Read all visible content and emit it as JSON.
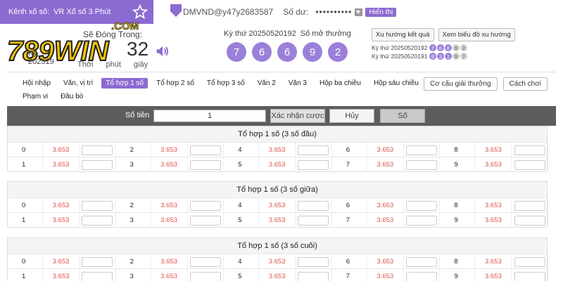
{
  "header": {
    "channel_label": "Kênh xổ số:",
    "channel_name": "VR Xổ số 3 Phút",
    "username": "DMVND@y47y2683587",
    "balance_label": "Số dư:",
    "balance_value": "••••••••••",
    "show_label": "Hiển thị",
    "logo_text": "789WIN",
    "logo_domain": ".COM",
    "close_label": "Sẽ Đóng Trong:",
    "period_prefix": "Kỳ",
    "period_fragment": "2025",
    "period_suffix": "19",
    "timer_value": "32",
    "unit_minute_prefix": "Thới",
    "unit_minute": "phút",
    "unit_second": "giây",
    "draw_label": "Kỳ thứ 20250520192",
    "draw_result_label": "Số mở thưởng",
    "balls": [
      "7",
      "6",
      "6",
      "9",
      "2"
    ],
    "trend_button": "Xu hướng kết quả",
    "chart_button": "Xem biểu đồ xu hướng",
    "history": [
      {
        "label": "Kỳ thứ 20250520192",
        "balls": [
          "7",
          "6",
          "6",
          "9",
          "2"
        ]
      },
      {
        "label": "Kỳ thứ 20250520191",
        "balls": [
          "9",
          "3",
          "1",
          "9",
          "7"
        ]
      }
    ]
  },
  "nav": {
    "row1": [
      "Hội nhập",
      "Văn, vị trí",
      "Tổ hợp 1 số",
      "Tổ hợp 2 số",
      "Tổ hợp 3 số",
      "Văn 2",
      "Văn 3",
      "Hộp ba chiều",
      "Hộp sáu chiều"
    ],
    "row2": [
      "Phạm vi",
      "Đầu bò"
    ],
    "active": "Tổ hợp 1 số",
    "reward_button": "Cơ cấu giải thưởng",
    "howto_button": "Cách chơi"
  },
  "bet_bar": {
    "amount_label": "Số tiền",
    "amount_value": "1",
    "confirm_button": "Xác nhận cược",
    "cancel_button": "Hủy",
    "number_button": "Số"
  },
  "sections": [
    {
      "title": "Tổ hợp 1 số (3 số đầu)",
      "rows": [
        [
          {
            "n": "0",
            "o": "3.653"
          },
          {
            "n": "2",
            "o": "3.653"
          },
          {
            "n": "4",
            "o": "3.653"
          },
          {
            "n": "6",
            "o": "3.653"
          },
          {
            "n": "8",
            "o": "3.653"
          }
        ],
        [
          {
            "n": "1",
            "o": "3.653"
          },
          {
            "n": "3",
            "o": "3.653"
          },
          {
            "n": "5",
            "o": "3.653"
          },
          {
            "n": "7",
            "o": "3.653"
          },
          {
            "n": "9",
            "o": "3.653"
          }
        ]
      ]
    },
    {
      "title": "Tổ hợp 1 số (3 số giữa)",
      "rows": [
        [
          {
            "n": "0",
            "o": "3.653"
          },
          {
            "n": "2",
            "o": "3.653"
          },
          {
            "n": "4",
            "o": "3.653"
          },
          {
            "n": "6",
            "o": "3.653"
          },
          {
            "n": "8",
            "o": "3.653"
          }
        ],
        [
          {
            "n": "1",
            "o": "3.653"
          },
          {
            "n": "3",
            "o": "3.653"
          },
          {
            "n": "5",
            "o": "3.653"
          },
          {
            "n": "7",
            "o": "3.653"
          },
          {
            "n": "9",
            "o": "3.653"
          }
        ]
      ]
    },
    {
      "title": "Tổ hợp 1 số (3 số cuối)",
      "rows": [
        [
          {
            "n": "0",
            "o": "3.653"
          },
          {
            "n": "2",
            "o": "3.653"
          },
          {
            "n": "4",
            "o": "3.653"
          },
          {
            "n": "6",
            "o": "3.653"
          },
          {
            "n": "8",
            "o": "3.653"
          }
        ],
        [
          {
            "n": "1",
            "o": "3.653"
          },
          {
            "n": "3",
            "o": "3.653"
          },
          {
            "n": "5",
            "o": "3.653"
          },
          {
            "n": "7",
            "o": "3.653"
          },
          {
            "n": "9",
            "o": "3.653"
          }
        ]
      ]
    }
  ],
  "colors": {
    "accent": "#8b6bd1",
    "ball": "#9b80da",
    "odds": "#d9534f",
    "bar": "#5d5d5d"
  }
}
